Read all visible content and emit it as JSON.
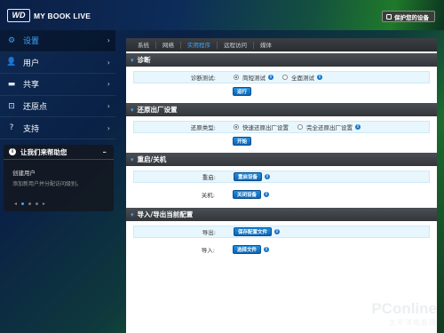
{
  "header": {
    "logo": "WD",
    "product": "MY BOOK LIVE",
    "protect_label": "保护您的设备"
  },
  "sidebar": {
    "items": [
      {
        "icon": "gear-icon",
        "label": "设置",
        "active": true
      },
      {
        "icon": "user-icon",
        "label": "用户"
      },
      {
        "icon": "folder-icon",
        "label": "共享"
      },
      {
        "icon": "restore-icon",
        "label": "还原点"
      },
      {
        "icon": "help-icon",
        "label": "支持"
      }
    ]
  },
  "help_panel": {
    "title": "让我们来帮助您",
    "item_title": "创建用户",
    "item_desc": "添加新用户并分配访问级别。"
  },
  "tabs": [
    {
      "label": "系统"
    },
    {
      "label": "网络"
    },
    {
      "label": "实用程序",
      "active": true
    },
    {
      "label": "远程访问"
    },
    {
      "label": "媒体"
    }
  ],
  "sections": {
    "diagnostics": {
      "title": "诊断",
      "test_label": "诊断测试:",
      "option_quick": "简短测试",
      "option_full": "全面测试",
      "run_button": "运行"
    },
    "factory_restore": {
      "title": "还原出厂设置",
      "type_label": "还原类型:",
      "option_quick": "快速还原出厂设置",
      "option_full": "完全还原出厂设置",
      "start_button": "开始"
    },
    "reboot": {
      "title": "重启/关机",
      "reboot_label": "重启:",
      "reboot_button": "重启设备",
      "shutdown_label": "关机:",
      "shutdown_button": "关闭设备"
    },
    "config": {
      "title": "导入/导出当前配置",
      "export_label": "导出:",
      "export_button": "保存配置文件",
      "import_label": "导入:",
      "import_button": "选择文件"
    }
  },
  "watermark": {
    "brand": "PConline",
    "sub": "太平洋电脑网"
  },
  "colors": {
    "accent": "#3fa5ff",
    "button": "#1a73c9",
    "highlight_row": "#e8f6fd"
  }
}
